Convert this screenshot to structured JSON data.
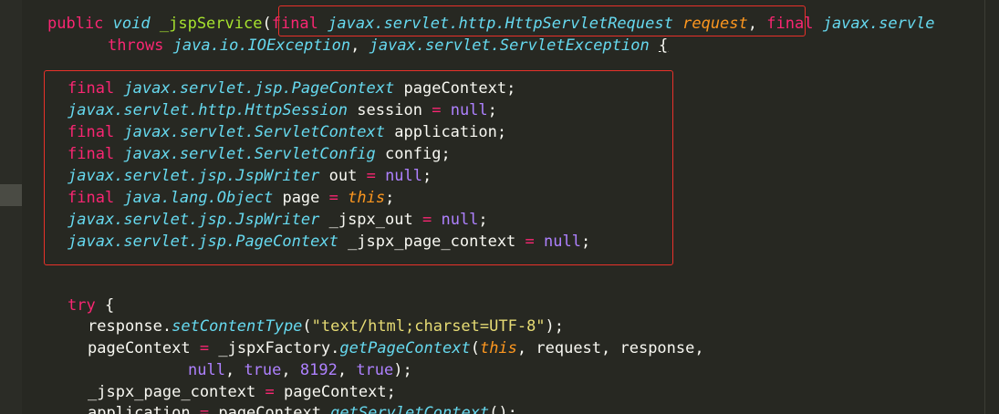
{
  "code": {
    "line1": {
      "t1": "public",
      "t2": "void",
      "t3": "_jspService",
      "t4": "(",
      "t5": "final",
      "t6": "javax.servlet.http.HttpServletRequest",
      "t7": "request",
      "t8": ",",
      "t9": "final",
      "t10": "javax.servle"
    },
    "line2": {
      "t1": "throws",
      "t2": "java.io.IOException",
      "t3": ",",
      "t4": "javax.servlet.ServletException",
      "t5": "{"
    },
    "decl": [
      {
        "mod": "final",
        "type": "javax.servlet.jsp.PageContext",
        "name": "pageContext;",
        "eq": "",
        "val": "",
        "end": ""
      },
      {
        "mod": "",
        "type": "javax.servlet.http.HttpSession",
        "name": "session",
        "eq": "=",
        "val": "null",
        "end": ";"
      },
      {
        "mod": "final",
        "type": "javax.servlet.ServletContext",
        "name": "application;",
        "eq": "",
        "val": "",
        "end": ""
      },
      {
        "mod": "final",
        "type": "javax.servlet.ServletConfig",
        "name": "config;",
        "eq": "",
        "val": "",
        "end": ""
      },
      {
        "mod": "",
        "type": "javax.servlet.jsp.JspWriter",
        "name": "out",
        "eq": "=",
        "val": "null",
        "end": ";"
      },
      {
        "mod": "final",
        "type": "java.lang.Object",
        "name": "page",
        "eq": "=",
        "val": "this",
        "end": ";"
      },
      {
        "mod": "",
        "type": "javax.servlet.jsp.JspWriter",
        "name": "_jspx_out",
        "eq": "=",
        "val": "null",
        "end": ";"
      },
      {
        "mod": "",
        "type": "javax.servlet.jsp.PageContext",
        "name": "_jspx_page_context",
        "eq": "=",
        "val": "null",
        "end": ";"
      }
    ],
    "try_line": {
      "kw": "try",
      "brace": "{"
    },
    "set_ct": {
      "obj": "response.",
      "method": "setContentType",
      "open": "(",
      "arg": "\"text/html;charset=UTF-8\"",
      "close": ");"
    },
    "get_pc": {
      "lhs": "pageContext",
      "eq": "=",
      "obj": "_jspxFactory.",
      "method": "getPageContext",
      "open": "(",
      "arg1": "this",
      "rest": ", request, response,"
    },
    "get_pc_cont": {
      "a1": "null",
      "c1": ", ",
      "a2": "true",
      "c2": ", ",
      "a3": "8192",
      "c3": ", ",
      "a4": "true",
      "close": ");"
    },
    "jspx_assign": {
      "lhs": "_jspx_page_context",
      "eq": "=",
      "rhs": "pageContext;"
    },
    "app_assign": {
      "lhs": "application",
      "eq": "=",
      "obj": "pageContext.",
      "method": "getServletContext",
      "close": "();"
    }
  }
}
